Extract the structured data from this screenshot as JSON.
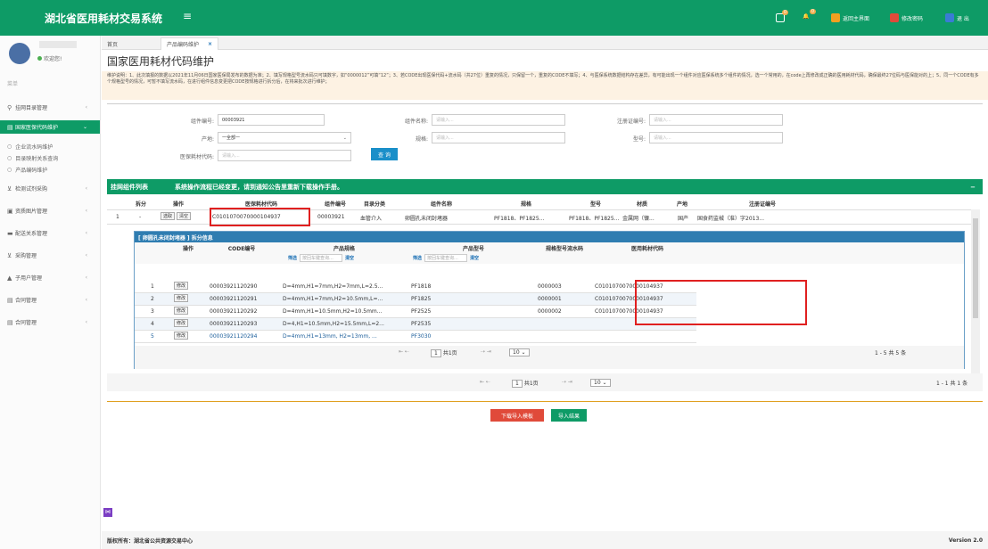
{
  "header": {
    "title": "湖北省医用耗材交易系统",
    "menu_icon": "hamburger-icon",
    "mail_badge": "0",
    "bell_badge": "0",
    "home_label": "返回主界面",
    "pwd_label": "修改密码",
    "exit_label": "退 出"
  },
  "sidebar": {
    "welcome": "欢迎您!",
    "menu_label": "菜单",
    "items": [
      {
        "label": "挂网目录管理",
        "icon": "location-icon"
      },
      {
        "label": "国家医保代码维护",
        "icon": "doc-icon",
        "active": true
      },
      {
        "label": "检测试剂采购",
        "icon": "cart-icon"
      },
      {
        "label": "资质图片管理",
        "icon": "image-icon"
      },
      {
        "label": "配送关系管理",
        "icon": "truck-icon"
      },
      {
        "label": "采购管理",
        "icon": "cart-icon"
      },
      {
        "label": "子用户管理",
        "icon": "user-icon"
      },
      {
        "label": "合同管理",
        "icon": "doc-icon"
      },
      {
        "label": "合同管理",
        "icon": "doc-icon"
      }
    ],
    "subitems": [
      "企业流水码维护",
      "目录映射关系查询",
      "产品编码维护"
    ]
  },
  "tabs": {
    "home": "首页",
    "current": "产品编码维护",
    "close": "×"
  },
  "page": {
    "title": "国家医用耗材代码维护",
    "notice": "维护说明：1、此次填报的数据以2021年11月06日国家医保局发布的数据为准；2、填写规格型号流水码只可填数字，如“0000012”可填“12”；3、若CODE出现医保代码+流水码（共27位）重复的情况，只保留一个，重复的CODE不填写；4、与医保系统数据结构存在差异，有可能出现一个组件对应医保系统多个组件的情况，选一个常用的，在code上再修改成正确的医用耗材代码，确保最终27位码与医保能对的上；5、同一个CODE有多个规格型号的情况，可暂不填写流水码，在进行组件信息变更把CODE按规格进行拆分后，在将来批次进行维护；"
  },
  "filter": {
    "component_no_label": "组件编号:",
    "component_no_value": "00003921",
    "component_name_label": "组件名称:",
    "component_name_ph": "请输入...",
    "reg_no_label": "注册证编号:",
    "reg_no_ph": "请输入...",
    "origin_label": "产地:",
    "origin_value": "一全部一",
    "spec_label": "规格:",
    "spec_ph": "请输入...",
    "model_label": "型号:",
    "model_ph": "请输入...",
    "code_label": "医保耗材代码:",
    "code_ph": "请输入...",
    "query": "查 询"
  },
  "list": {
    "title": "挂网组件列表",
    "notice": "系统操作流程已经变更，请到通知公告里重新下载操作手册。",
    "min": "−",
    "headers": [
      "拆分",
      "操作",
      "医保耗材代码",
      "组件编号",
      "目录分类",
      "组件名称",
      "规格",
      "型号",
      "材质",
      "产地",
      "注册证编号"
    ],
    "row": {
      "index": "1",
      "split": "-",
      "choose": "选取",
      "clear": "清空",
      "code": "C0101070070000104937",
      "comp_no": "00003921",
      "category": "血管介入",
      "name": "卵圆孔未闭封堵器",
      "spec": "PF1818、PF1825...",
      "model": "PF1818、PF1825...",
      "material": "金属网（镍...",
      "origin": "国产",
      "reg": "国食药监械（准）字2013..."
    }
  },
  "split": {
    "title": "[ 卵圆孔未闭封堵器 ] 拆分信息",
    "headers": {
      "op": "操作",
      "code": "CODE编号",
      "spec": "产品规格",
      "model": "产品型号",
      "serial": "规格型号流水码",
      "med_code": "医用耗材代码"
    },
    "filter_label": "筛选",
    "filter_ph": "按回车键查询...",
    "clear_label": "清空",
    "edit": "修改",
    "rows": [
      {
        "no": "1",
        "code": "00003921120290",
        "spec": "D=4mm,H1=7mm,H2=7mm,L=2.5...",
        "model": "PF1818",
        "serial": "0000003",
        "med": "C0101070070000104937"
      },
      {
        "no": "2",
        "code": "00003921120291",
        "spec": "D=4mm,H1=7mm,H2=10.5mm,L=...",
        "model": "PF1825",
        "serial": "0000001",
        "med": "C0101070070000104937"
      },
      {
        "no": "3",
        "code": "00003921120292",
        "spec": "D=4mm,H1=10.5mm,H2=10.5mm...",
        "model": "PF2525",
        "serial": "0000002",
        "med": "C0101070070000104937"
      },
      {
        "no": "4",
        "code": "00003921120293",
        "spec": "D=4,H1=10.5mm,H2=15.5mm,L=2...",
        "model": "PF2535",
        "serial": "",
        "med": ""
      },
      {
        "no": "5",
        "code": "00003921120294",
        "spec": "D=4mm,H1=13mm,  H2=13mm,  ...",
        "model": "PF3030",
        "serial": "",
        "med": ""
      }
    ],
    "pager": {
      "page": "1",
      "total_pages": "共1页",
      "size": "10",
      "summary": "1 - 5  共 5 条"
    }
  },
  "outer_pager": {
    "page": "1",
    "total_pages": "共1页",
    "size": "10",
    "summary": "1 - 1  共 1 条"
  },
  "actions": {
    "download": "下载导入模板",
    "import": "导入结果"
  },
  "footer": {
    "copyright": "版权所有：湖北省公共资源交易中心",
    "version": "Version 2.0"
  },
  "colors": {
    "brand": "#0e9b66",
    "highlight": "#e02020",
    "accent_blue": "#1a8fc9"
  }
}
